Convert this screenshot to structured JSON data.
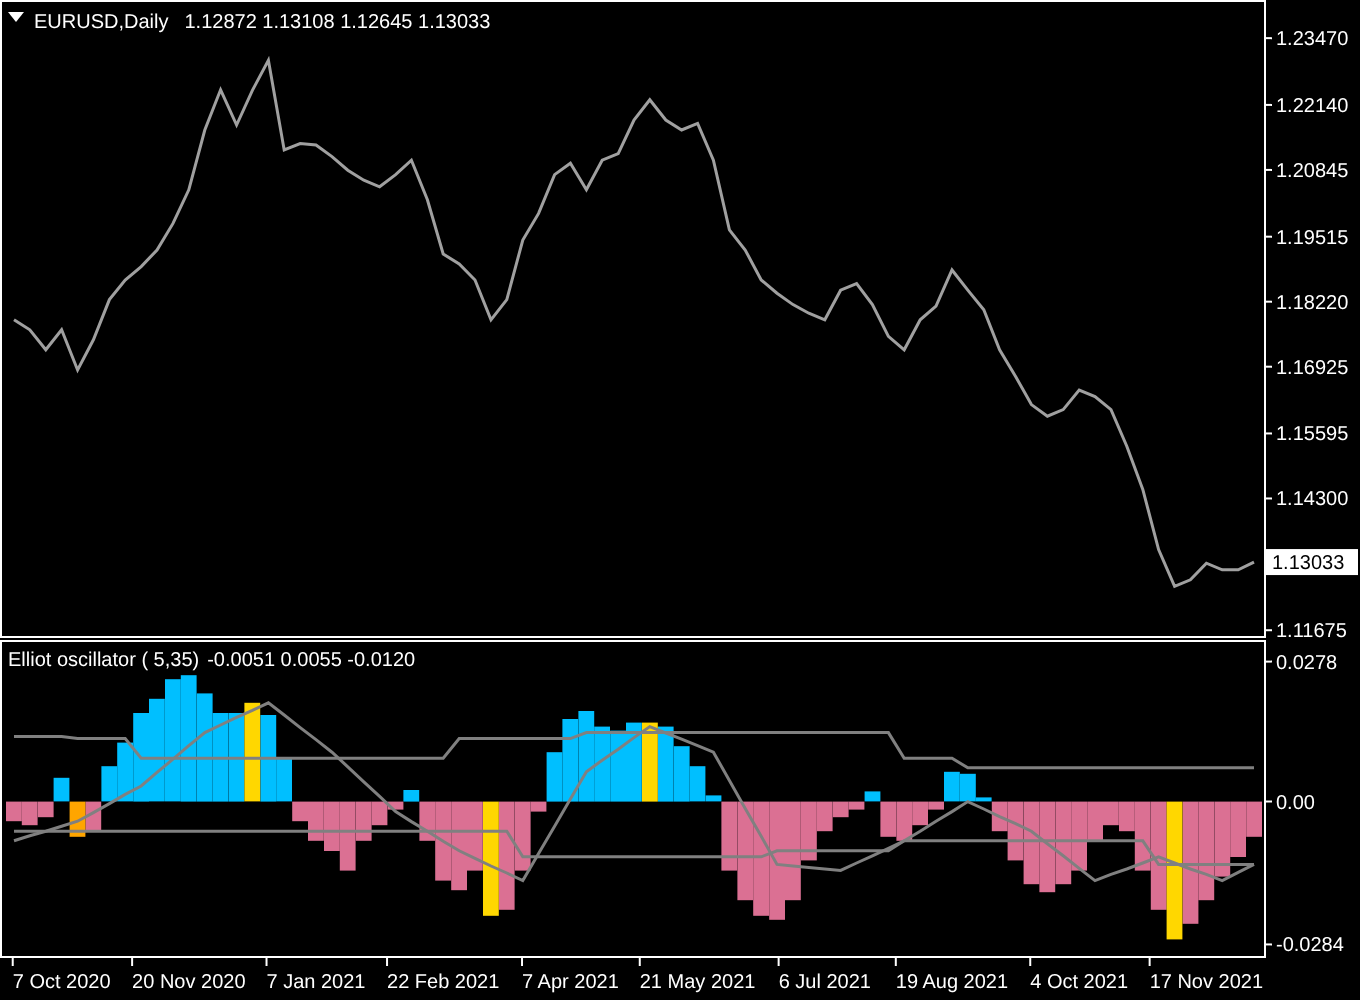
{
  "price_panel": {
    "title": "EURUSD,Daily",
    "quote": "1.12872 1.13108 1.12645 1.13033",
    "current_price": "1.13033",
    "chart_data": {
      "type": "line",
      "ylim": [
        1.1156,
        1.2415
      ],
      "series": [
        {
          "color": "#a0a0a0",
          "values": [
            1.1786,
            1.1766,
            1.1726,
            1.1766,
            1.1686,
            1.1746,
            1.1826,
            1.1865,
            1.1892,
            1.1925,
            1.1978,
            1.2045,
            1.2164,
            1.2244,
            1.2174,
            1.2243,
            1.2303,
            1.2124,
            1.2137,
            1.2134,
            1.2111,
            1.2084,
            1.2064,
            1.2051,
            1.2075,
            1.2104,
            1.2025,
            1.1917,
            1.1897,
            1.1865,
            1.1786,
            1.1826,
            1.1945,
            1.1998,
            1.2075,
            1.2098,
            1.2045,
            1.2104,
            1.2117,
            1.2184,
            1.2224,
            1.2184,
            1.2164,
            1.2177,
            1.2104,
            1.1965,
            1.1925,
            1.1865,
            1.1839,
            1.1816,
            1.1799,
            1.1786,
            1.1845,
            1.1858,
            1.1816,
            1.1753,
            1.1726,
            1.1786,
            1.1813,
            1.1885,
            1.1845,
            1.1806,
            1.1726,
            1.1673,
            1.1617,
            1.1594,
            1.1607,
            1.1646,
            1.1633,
            1.1607,
            1.1534,
            1.1448,
            1.1328,
            1.1255,
            1.1268,
            1.1301,
            1.1288,
            1.1288,
            1.1303
          ]
        }
      ],
      "yticks": [
        {
          "value": 1.2347,
          "label": "1.23470"
        },
        {
          "value": 1.2214,
          "label": "1.22140"
        },
        {
          "value": 1.20845,
          "label": "1.20845"
        },
        {
          "value": 1.19515,
          "label": "1.19515"
        },
        {
          "value": 1.1822,
          "label": "1.18220"
        },
        {
          "value": 1.16925,
          "label": "1.16925"
        },
        {
          "value": 1.15595,
          "label": "1.15595"
        },
        {
          "value": 1.143,
          "label": "1.14300"
        },
        {
          "value": 1.11675,
          "label": "1.11675"
        }
      ]
    }
  },
  "oscillator_panel": {
    "title": "Elliot oscillator ( 5,35)",
    "readings": "-0.0051 0.0055 -0.0120",
    "chart_data": {
      "type": "bar",
      "stacked": true,
      "ylim": [
        -0.0307,
        0.0313
      ],
      "categories": [
        null,
        null,
        null,
        "7 Oct 2020",
        null,
        null,
        null,
        null,
        null,
        null,
        null,
        "20 Nov 2020",
        null,
        null,
        null,
        null,
        null,
        null,
        null,
        "7 Jan 2021",
        null,
        null,
        null,
        null,
        null,
        null,
        null,
        "22 Feb 2021",
        null,
        null,
        null,
        null,
        null,
        null,
        null,
        "7 Apr 2021",
        null,
        null,
        null,
        null,
        null,
        null,
        null,
        "21 May 2021",
        null,
        null,
        null,
        null,
        null,
        null,
        null,
        "6 Jul 2021",
        null,
        null,
        null,
        null,
        null,
        null,
        null,
        "19 Aug 2021",
        null,
        null,
        null,
        null,
        null,
        null,
        null,
        "4 Oct 2021",
        null,
        null,
        null,
        null,
        null,
        null,
        null,
        "17 Nov 2021",
        null,
        null,
        null
      ],
      "series": [
        {
          "color": "#00bfff",
          "values": [
            null,
            null,
            null,
            0.0047,
            null,
            null,
            0.007,
            0.0117,
            0.0176,
            0.0204,
            0.0243,
            0.0251,
            0.0215,
            0.0176,
            0.0176,
            null,
            0.0172,
            0.0086,
            null,
            null,
            null,
            null,
            null,
            null,
            null,
            0.0023,
            null,
            null,
            null,
            null,
            null,
            null,
            null,
            null,
            0.0098,
            0.0164,
            0.018,
            0.0149,
            0.0141,
            0.0157,
            null,
            0.0149,
            0.011,
            0.007,
            0.0012,
            null,
            null,
            null,
            null,
            null,
            null,
            null,
            null,
            null,
            0.002,
            null,
            null,
            null,
            null,
            0.0059,
            0.0055,
            0.0008,
            null,
            null,
            null,
            null,
            null,
            null,
            null,
            null,
            null,
            null,
            null,
            null,
            null,
            null,
            null,
            null,
            null
          ]
        },
        {
          "color": "#db7093",
          "values": [
            -0.0039,
            -0.0047,
            -0.0031,
            null,
            null,
            -0.0059,
            null,
            null,
            null,
            null,
            null,
            null,
            null,
            null,
            null,
            null,
            null,
            null,
            -0.0039,
            -0.0078,
            -0.0098,
            -0.0137,
            -0.0078,
            -0.0047,
            -0.0016,
            null,
            -0.0078,
            -0.0157,
            -0.0176,
            -0.0137,
            null,
            -0.0215,
            -0.0137,
            -0.002,
            null,
            null,
            null,
            null,
            null,
            null,
            null,
            null,
            null,
            null,
            null,
            -0.0137,
            -0.0196,
            -0.0227,
            -0.0235,
            -0.0196,
            -0.0117,
            -0.0059,
            -0.0031,
            -0.0016,
            null,
            -0.007,
            -0.0078,
            -0.0047,
            -0.0016,
            null,
            null,
            null,
            -0.0059,
            -0.0117,
            -0.0164,
            -0.018,
            -0.0164,
            -0.0137,
            -0.0078,
            -0.0047,
            -0.0059,
            -0.0137,
            -0.0215,
            null,
            -0.0243,
            -0.0196,
            -0.0149,
            -0.011,
            -0.007
          ]
        },
        {
          "color": "#ffd700",
          "values": [
            null,
            null,
            null,
            null,
            null,
            null,
            null,
            null,
            null,
            null,
            null,
            null,
            null,
            null,
            null,
            0.0196,
            null,
            null,
            null,
            null,
            null,
            null,
            null,
            null,
            null,
            null,
            null,
            null,
            null,
            null,
            -0.0227,
            null,
            null,
            null,
            null,
            null,
            null,
            null,
            null,
            null,
            0.0157,
            null,
            null,
            null,
            null,
            null,
            null,
            null,
            null,
            null,
            null,
            null,
            null,
            null,
            null,
            null,
            null,
            null,
            null,
            null,
            null,
            null,
            null,
            null,
            null,
            null,
            null,
            null,
            null,
            null,
            null,
            null,
            null,
            -0.0274,
            null,
            null,
            null,
            null,
            null
          ]
        },
        {
          "color": "#ffa500",
          "values": [
            null,
            null,
            null,
            null,
            -0.007,
            null,
            null,
            null,
            null,
            null,
            null,
            null,
            null,
            null,
            null,
            null,
            null,
            null,
            null,
            null,
            null,
            null,
            null,
            null,
            null,
            null,
            null,
            null,
            null,
            null,
            null,
            null,
            null,
            null,
            null,
            null,
            null,
            null,
            null,
            null,
            null,
            null,
            null,
            null,
            null,
            null,
            null,
            null,
            null,
            null,
            null,
            null,
            null,
            null,
            null,
            null,
            null,
            null,
            null,
            null,
            null,
            null,
            null,
            null,
            null,
            null,
            null,
            null,
            null,
            null,
            null,
            null,
            null,
            null,
            null,
            null,
            null,
            null,
            null
          ]
        },
        {
          "type": "line",
          "color": "#808080",
          "values": [
            0.0129,
            0.0129,
            0.0129,
            0.0129,
            0.0125,
            0.0125,
            0.0125,
            0.0125,
            0.0086,
            0.0086,
            0.0086,
            0.0086,
            0.0086,
            0.0086,
            0.0086,
            0.0086,
            0.0086,
            0.0086,
            0.0086,
            0.0086,
            0.0086,
            0.0086,
            0.0086,
            0.0086,
            0.0086,
            0.0086,
            0.0086,
            0.0086,
            0.0125,
            0.0125,
            0.0125,
            0.0125,
            0.0125,
            0.0125,
            0.0125,
            0.0125,
            0.0137,
            0.0137,
            0.0137,
            0.0137,
            0.0137,
            0.0137,
            0.0137,
            0.0137,
            0.0137,
            0.0137,
            0.0137,
            0.0137,
            0.0137,
            0.0137,
            0.0137,
            0.0137,
            0.0137,
            0.0137,
            0.0137,
            0.0137,
            0.0086,
            0.0086,
            0.0086,
            0.0086,
            0.0067,
            0.0067,
            0.0067,
            0.0067,
            0.0067,
            0.0067,
            0.0067,
            0.0067,
            0.0067,
            0.0067,
            0.0067,
            0.0067,
            0.0067,
            0.0067,
            0.0067,
            0.0067,
            0.0067,
            0.0067,
            0.0067
          ]
        },
        {
          "type": "line",
          "color": "#808080",
          "values": [
            -0.0059,
            -0.0059,
            -0.0059,
            -0.0059,
            -0.0059,
            -0.0059,
            -0.0059,
            -0.0059,
            -0.0059,
            -0.0059,
            -0.0059,
            -0.0059,
            -0.0059,
            -0.0059,
            -0.0059,
            -0.0059,
            -0.0059,
            -0.0059,
            -0.0059,
            -0.0059,
            -0.0059,
            -0.0059,
            -0.0059,
            -0.0059,
            -0.0059,
            -0.0059,
            -0.0059,
            -0.0059,
            -0.0059,
            -0.0059,
            -0.0059,
            -0.0059,
            -0.011,
            -0.011,
            -0.011,
            -0.011,
            -0.011,
            -0.011,
            -0.011,
            -0.011,
            -0.011,
            -0.011,
            -0.011,
            -0.011,
            -0.011,
            -0.011,
            -0.011,
            -0.011,
            -0.0098,
            -0.0098,
            -0.0098,
            -0.0098,
            -0.0098,
            -0.0098,
            -0.0098,
            -0.0098,
            -0.0078,
            -0.0078,
            -0.0078,
            -0.0078,
            -0.0078,
            -0.0078,
            -0.0078,
            -0.0078,
            -0.0078,
            -0.0078,
            -0.0078,
            -0.0078,
            -0.0078,
            -0.0078,
            -0.0078,
            -0.0078,
            -0.0125,
            -0.0125,
            -0.0125,
            -0.0125,
            -0.0125,
            -0.0125,
            -0.0125
          ]
        },
        {
          "type": "line",
          "color": "#808080",
          "values": [
            -0.0078,
            -0.0068,
            -0.0059,
            -0.0049,
            -0.0039,
            -0.0022,
            -0.0004,
            0.0014,
            0.0031,
            0.0058,
            0.0084,
            0.0111,
            0.0137,
            0.0152,
            0.0167,
            0.0181,
            0.0196,
            0.0172,
            0.0147,
            0.0123,
            0.0098,
            0.0069,
            0.0039,
            0.001,
            -0.002,
            -0.004,
            -0.0059,
            -0.0079,
            -0.0098,
            -0.0113,
            -0.0128,
            -0.0142,
            -0.0157,
            -0.0103,
            -0.0049,
            0.0005,
            0.0059,
            0.0082,
            0.0104,
            0.0127,
            0.0149,
            0.0136,
            0.0124,
            0.0111,
            0.0098,
            0.0042,
            -0.0014,
            -0.0069,
            -0.0125,
            -0.0128,
            -0.0131,
            -0.0134,
            -0.0137,
            -0.0122,
            -0.0108,
            -0.0093,
            -0.0078,
            -0.0059,
            -0.0039,
            -0.002,
            0.0,
            -0.0015,
            -0.003,
            -0.0044,
            -0.0059,
            -0.0084,
            -0.0108,
            -0.0133,
            -0.0157,
            -0.0145,
            -0.0134,
            -0.0122,
            -0.011,
            -0.0122,
            -0.0134,
            -0.0145,
            -0.0157,
            -0.0141,
            -0.0125
          ]
        }
      ],
      "yticks": [
        {
          "value": 0.0278,
          "label": "0.0278"
        },
        {
          "value": 0,
          "label": "0.00"
        },
        {
          "value": -0.0284,
          "label": "-0.0284"
        }
      ]
    }
  }
}
